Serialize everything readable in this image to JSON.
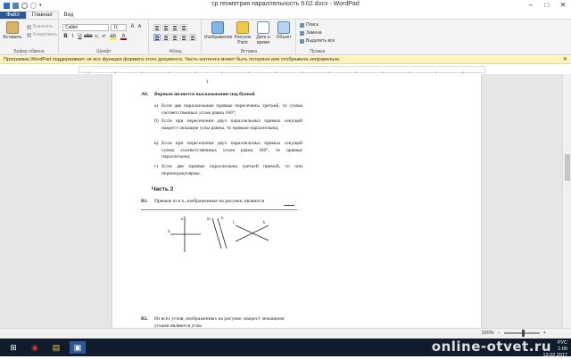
{
  "window": {
    "title": "ср геометрия параллельность 9.02.docx - WordPad",
    "controls": [
      "minimize",
      "maximize",
      "close"
    ]
  },
  "tabs": [
    "Файл",
    "Главная",
    "Вид"
  ],
  "ribbon": {
    "clipboard": {
      "paste": "Вставить",
      "cut": "Вырезать",
      "copy": "Копировать",
      "label": "Буфер обмена"
    },
    "font": {
      "family": "Calibri",
      "size": "11",
      "label": "Шрифт"
    },
    "paragraph": {
      "label": "Абзац"
    },
    "insert": {
      "picture": "Изображение",
      "paint": "Рисунок Paint",
      "datetime": "Дата и время",
      "object": "Объект",
      "label": "Вставка"
    },
    "editing": {
      "find": "Поиск",
      "replace": "Замена",
      "select_all": "Выделить все",
      "label": "Правка"
    }
  },
  "infobar": {
    "text": "Программа WordPad поддерживает не все функции формата этого документа. Часть контента может быть потеряна или отображена неправильно."
  },
  "document": {
    "stray": "1",
    "a8": {
      "num": "А8.",
      "text": "Верным является высказывание под буквой"
    },
    "options": [
      {
        "letter": "а)",
        "text": "Если две параллельные прямые пересечены третьей, то сумма соответственных углов равна 180°;"
      },
      {
        "letter": "б)",
        "text": "Если при пересечении двух параллельных прямых секущей накрест лежащие углы равны, то прямые параллельны;"
      },
      {
        "letter": "в)",
        "text": "Если при пересечении двух параллельных прямых секущей сумма соответственных углов равна 180°, то прямые параллельны;"
      },
      {
        "letter": "г)",
        "text": "Если две прямые параллельны третьей прямой, то они перпендикулярны."
      }
    ],
    "part2": "Часть 2",
    "b1": {
      "num": "В1.",
      "text": "Прямые m и n, изображенные на рисунке, являются"
    },
    "figure_labels": {
      "a": "a",
      "b": "b",
      "m": "m",
      "n": "n",
      "k": "k",
      "l": "l"
    },
    "b2": {
      "num": "В2.",
      "text": "Из всех углов, изображенных на рисунке, накрест лежащими углами являются углы"
    }
  },
  "statusbar": {
    "zoom": "100%"
  },
  "taskbar": {
    "time": "1:00",
    "date": "13.02.2017",
    "lang": "РУС"
  },
  "watermark": "online-otvet.ru"
}
